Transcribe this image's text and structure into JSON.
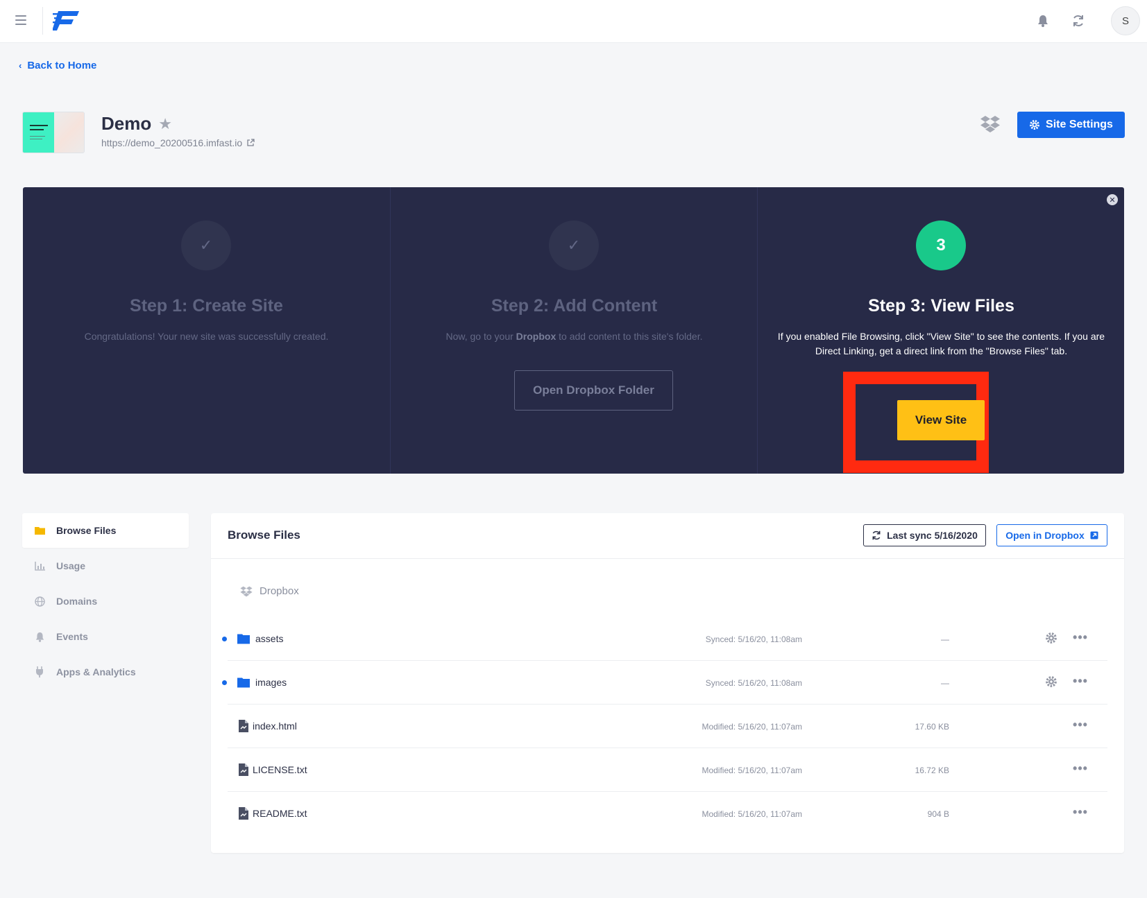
{
  "header": {
    "avatar_initial": "S"
  },
  "back_link": "Back to Home",
  "site": {
    "name": "Demo",
    "url": "https://demo_20200516.imfast.io",
    "settings_label": "Site Settings"
  },
  "steps": [
    {
      "number": "1",
      "title": "Step 1: Create Site",
      "description": "Congratulations! Your new site was successfully created."
    },
    {
      "number": "2",
      "title": "Step 2: Add Content",
      "description_prefix": "Now, go to your ",
      "description_bold": "Dropbox",
      "description_suffix": " to add content to this site's folder.",
      "button_label": "Open Dropbox Folder"
    },
    {
      "number": "3",
      "title": "Step 3: View Files",
      "description": "If you enabled File Browsing, click \"View Site\" to see the contents. If you are Direct Linking, get a direct link from the \"Browse Files\" tab.",
      "button_label": "View Site"
    }
  ],
  "sidebar": {
    "items": [
      {
        "label": "Browse Files",
        "icon": "folder-icon",
        "active": true
      },
      {
        "label": "Usage",
        "icon": "chart-icon"
      },
      {
        "label": "Domains",
        "icon": "globe-icon"
      },
      {
        "label": "Events",
        "icon": "bell-icon"
      },
      {
        "label": "Apps & Analytics",
        "icon": "plug-icon"
      }
    ]
  },
  "browse": {
    "title": "Browse Files",
    "sync_label": "Last sync 5/16/2020",
    "open_dropbox_label": "Open in Dropbox",
    "breadcrumb": "Dropbox",
    "files": [
      {
        "name": "assets",
        "type": "folder",
        "status": "Synced: 5/16/20, 11:08am",
        "size": "—"
      },
      {
        "name": "images",
        "type": "folder",
        "status": "Synced: 5/16/20, 11:08am",
        "size": "—"
      },
      {
        "name": "index.html",
        "type": "file",
        "status": "Modified: 5/16/20, 11:07am",
        "size": "17.60 KB"
      },
      {
        "name": "LICENSE.txt",
        "type": "file",
        "status": "Modified: 5/16/20, 11:07am",
        "size": "16.72 KB"
      },
      {
        "name": "README.txt",
        "type": "file",
        "status": "Modified: 5/16/20, 11:07am",
        "size": "904 B"
      }
    ]
  },
  "colors": {
    "brand_blue": "#1769e8",
    "panel_bg": "#272a47",
    "success_green": "#19c98a",
    "cta_yellow": "#ffc015",
    "highlight_red": "#ff2a10"
  }
}
